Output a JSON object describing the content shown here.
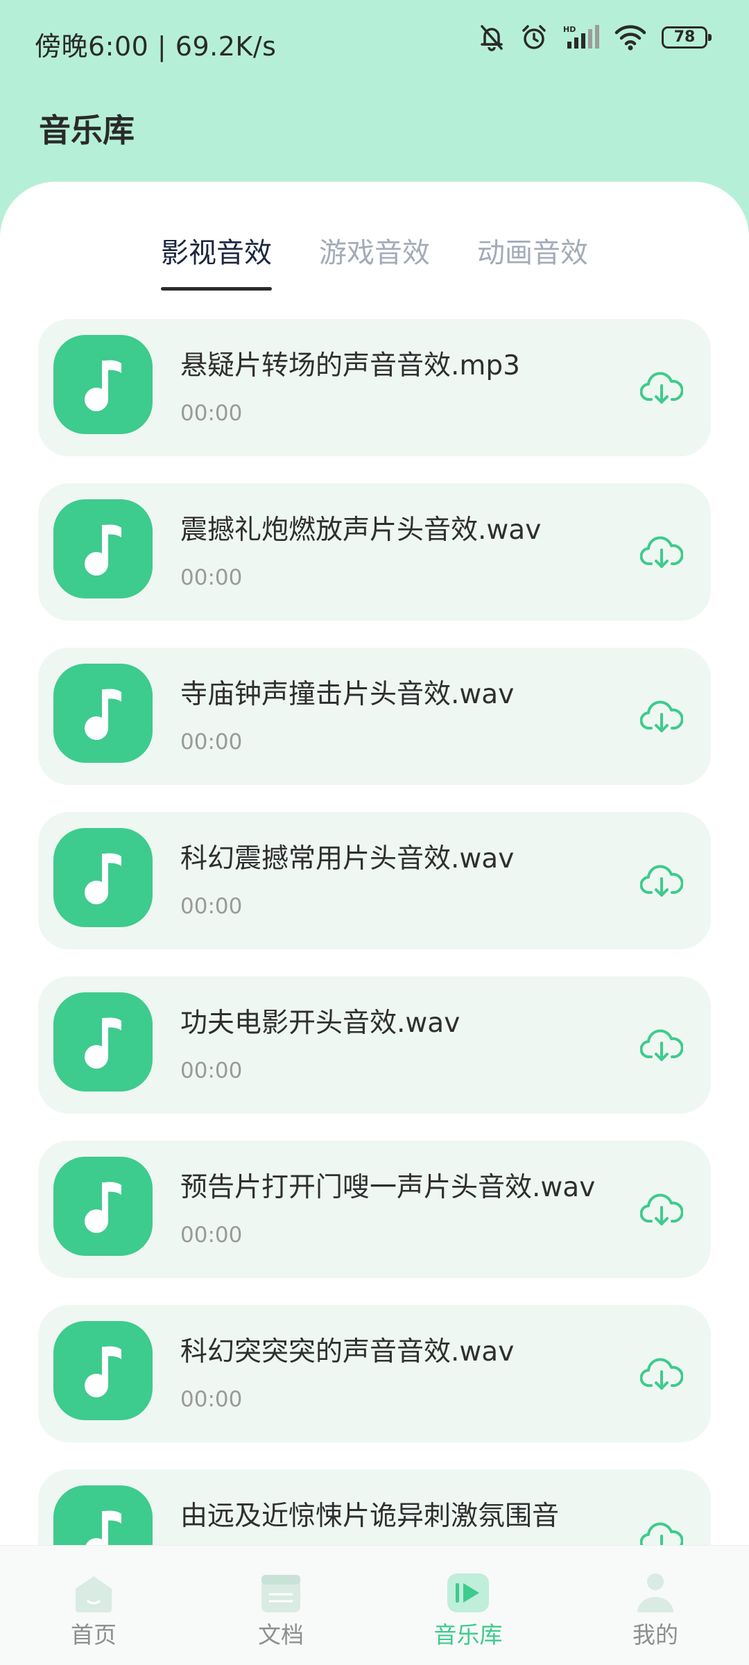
{
  "status_bar": {
    "time_speed": "傍晚6:00 | 69.2K/s",
    "battery": "78",
    "icons": [
      "bell-muted-icon",
      "alarm-icon",
      "hd-signal-icon",
      "wifi-icon",
      "battery-icon"
    ]
  },
  "header": {
    "title": "音乐库"
  },
  "tabs": [
    {
      "label": "影视音效",
      "active": true
    },
    {
      "label": "游戏音效",
      "active": false
    },
    {
      "label": "动画音效",
      "active": false
    }
  ],
  "items": [
    {
      "title": "悬疑片转场的声音音效.mp3",
      "duration": "00:00"
    },
    {
      "title": "震撼礼炮燃放声片头音效.wav",
      "duration": "00:00"
    },
    {
      "title": "寺庙钟声撞击片头音效.wav",
      "duration": "00:00"
    },
    {
      "title": "科幻震撼常用片头音效.wav",
      "duration": "00:00"
    },
    {
      "title": "功夫电影开头音效.wav",
      "duration": "00:00"
    },
    {
      "title": "预告片打开门嗖一声片头音效.wav",
      "duration": "00:00"
    },
    {
      "title": "科幻突突突的声音音效.wav",
      "duration": "00:00"
    },
    {
      "title": "由远及近惊悚片诡异刺激氛围音",
      "duration": ""
    }
  ],
  "bottom_nav": [
    {
      "label": "首页",
      "icon": "home-icon",
      "active": false
    },
    {
      "label": "文档",
      "icon": "document-icon",
      "active": false
    },
    {
      "label": "音乐库",
      "icon": "music-library-icon",
      "active": true
    },
    {
      "label": "我的",
      "icon": "profile-icon",
      "active": false
    }
  ],
  "colors": {
    "header_bg": "#b6efd7",
    "accent": "#3ecb8e",
    "card_bg": "#eff7f2",
    "tab_active": "#1c2740",
    "tab_inactive": "#a3abb9"
  }
}
